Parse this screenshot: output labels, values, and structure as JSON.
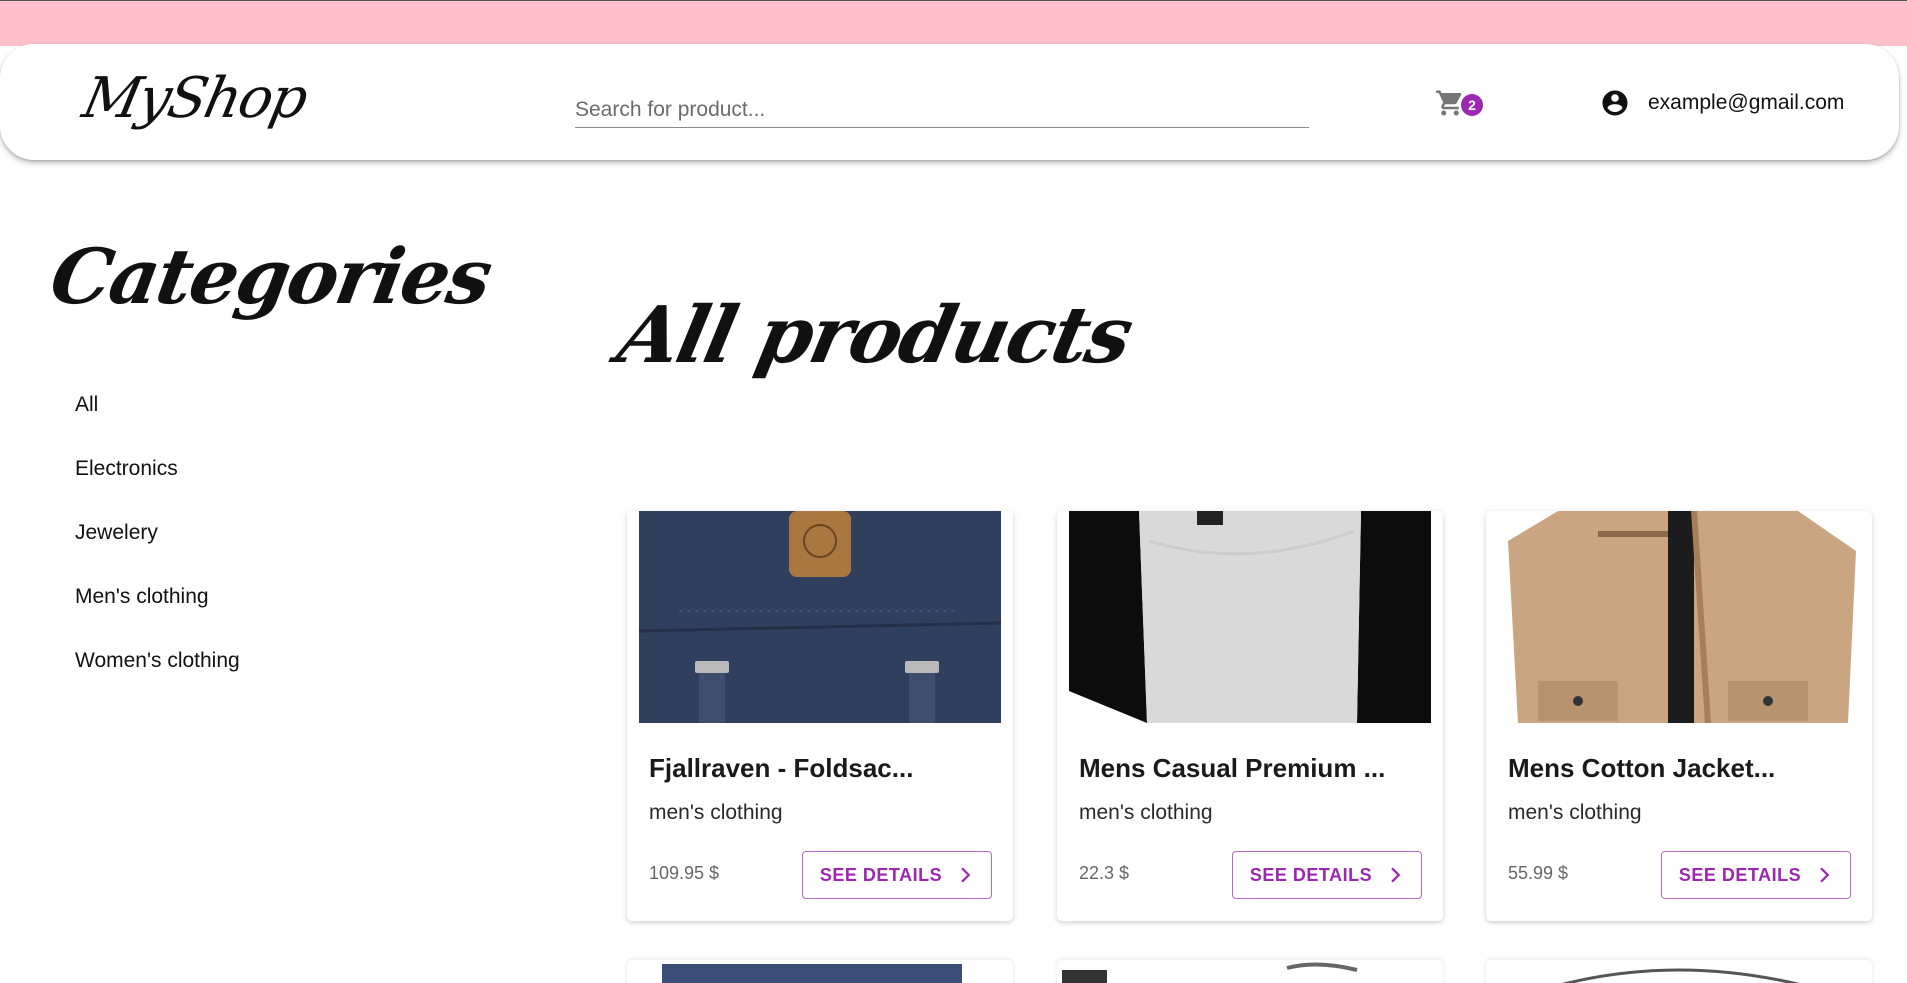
{
  "header": {
    "logo": "MyShop",
    "search_placeholder": "Search for product...",
    "cart_count": "2",
    "cart_icon": "shopping-cart-icon",
    "account_icon": "account-circle-icon",
    "account_email": "example@gmail.com"
  },
  "sidebar": {
    "title": "Categories",
    "items": [
      {
        "label": "All"
      },
      {
        "label": "Electronics"
      },
      {
        "label": "Jewelery"
      },
      {
        "label": "Men's clothing"
      },
      {
        "label": "Women's clothing"
      }
    ]
  },
  "main": {
    "title": "All products",
    "products": [
      {
        "title": "Fjallraven - Foldsac...",
        "category": "men's clothing",
        "price": "109.95 $",
        "button": "SEE DETAILS"
      },
      {
        "title": "Mens Casual Premium ...",
        "category": "men's clothing",
        "price": "22.3 $",
        "button": "SEE DETAILS"
      },
      {
        "title": "Mens Cotton Jacket...",
        "category": "men's clothing",
        "price": "55.99 $",
        "button": "SEE DETAILS"
      }
    ]
  },
  "colors": {
    "top_band": "#ffc0cb",
    "accent": "#9c27b0"
  }
}
